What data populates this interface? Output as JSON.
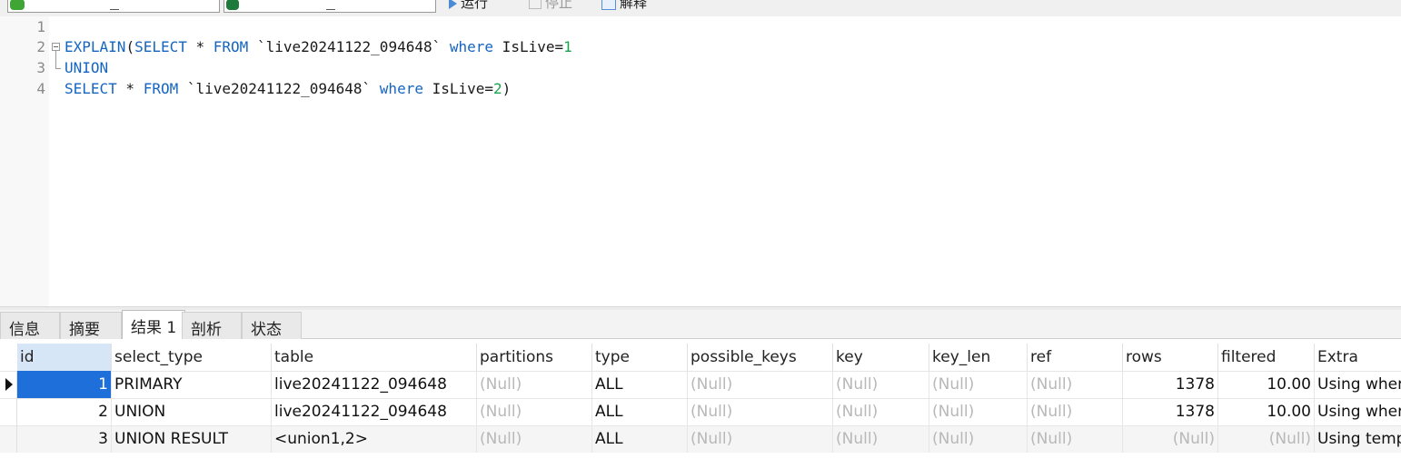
{
  "toolbar": {
    "run_label": "运行",
    "stop_label": "停止",
    "explain_label": "解释"
  },
  "editor": {
    "line_numbers": [
      "1",
      "2",
      "3",
      "4"
    ],
    "lines": [
      [],
      [
        {
          "t": "EXPLAIN",
          "c": "kw"
        },
        {
          "t": "(",
          "c": "txt"
        },
        {
          "t": "SELECT",
          "c": "kw"
        },
        {
          "t": " * ",
          "c": "txt"
        },
        {
          "t": "FROM",
          "c": "kw"
        },
        {
          "t": " `live20241122_094648` ",
          "c": "txt"
        },
        {
          "t": "where",
          "c": "kw"
        },
        {
          "t": " IsLive=",
          "c": "txt"
        },
        {
          "t": "1",
          "c": "num"
        }
      ],
      [
        {
          "t": "UNION",
          "c": "kw"
        }
      ],
      [
        {
          "t": "SELECT",
          "c": "kw"
        },
        {
          "t": " * ",
          "c": "txt"
        },
        {
          "t": "FROM",
          "c": "kw"
        },
        {
          "t": " `live20241122_094648` ",
          "c": "txt"
        },
        {
          "t": "where",
          "c": "kw"
        },
        {
          "t": " IsLive=",
          "c": "txt"
        },
        {
          "t": "2",
          "c": "num"
        },
        {
          "t": ")",
          "c": "txt"
        }
      ]
    ]
  },
  "tabs": [
    "信息",
    "摘要",
    "结果 1",
    "剖析",
    "状态"
  ],
  "active_tab": "结果 1",
  "result": {
    "columns": [
      "id",
      "select_type",
      "table",
      "partitions",
      "type",
      "possible_keys",
      "key",
      "key_len",
      "ref",
      "rows",
      "filtered",
      "Extra"
    ],
    "rows": [
      [
        "1",
        "PRIMARY",
        "live20241122_094648",
        "(Null)",
        "ALL",
        "(Null)",
        "(Null)",
        "(Null)",
        "(Null)",
        "1378",
        "10.00",
        "Using where"
      ],
      [
        "2",
        "UNION",
        "live20241122_094648",
        "(Null)",
        "ALL",
        "(Null)",
        "(Null)",
        "(Null)",
        "(Null)",
        "1378",
        "10.00",
        "Using where"
      ],
      [
        "3",
        "UNION RESULT",
        "<union1,2>",
        "(Null)",
        "ALL",
        "(Null)",
        "(Null)",
        "(Null)",
        "(Null)",
        "(Null)",
        "(Null)",
        "Using temporary"
      ]
    ]
  },
  "colors": {
    "keyword": "#1565c0",
    "number": "#1aa34a",
    "selection": "#1e6fd9",
    "null_text": "#b8b8b8"
  }
}
